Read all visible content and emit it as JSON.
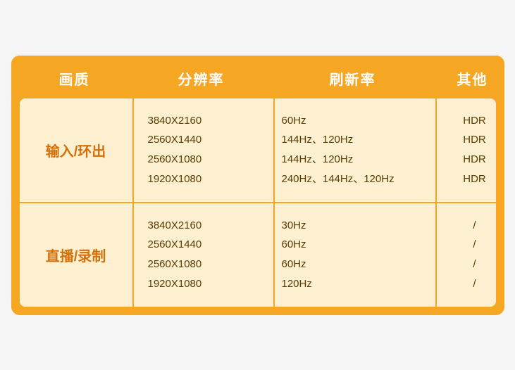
{
  "header": {
    "col1": "画质",
    "col2": "分辨率",
    "col3": "刷新率",
    "col4": "其他"
  },
  "rows": [
    {
      "label": "输入/环出",
      "resolutions": [
        "3840X2160",
        "2560X1440",
        "2560X1080",
        "1920X1080"
      ],
      "refresh_rates": [
        "60Hz",
        "144Hz、120Hz",
        "144Hz、120Hz",
        "240Hz、144Hz、120Hz"
      ],
      "others": [
        "HDR",
        "HDR",
        "HDR",
        "HDR"
      ]
    },
    {
      "label": "直播/录制",
      "resolutions": [
        "3840X2160",
        "2560X1440",
        "2560X1080",
        "1920X1080"
      ],
      "refresh_rates": [
        "30Hz",
        "60Hz",
        "60Hz",
        "120Hz"
      ],
      "others": [
        "/",
        "/",
        "/",
        "/"
      ]
    }
  ],
  "colors": {
    "orange": "#f5a623",
    "light_bg": "#fdf0d0",
    "text_dark": "#5a3a00",
    "label_color": "#d4700a",
    "header_text": "#ffffff"
  }
}
